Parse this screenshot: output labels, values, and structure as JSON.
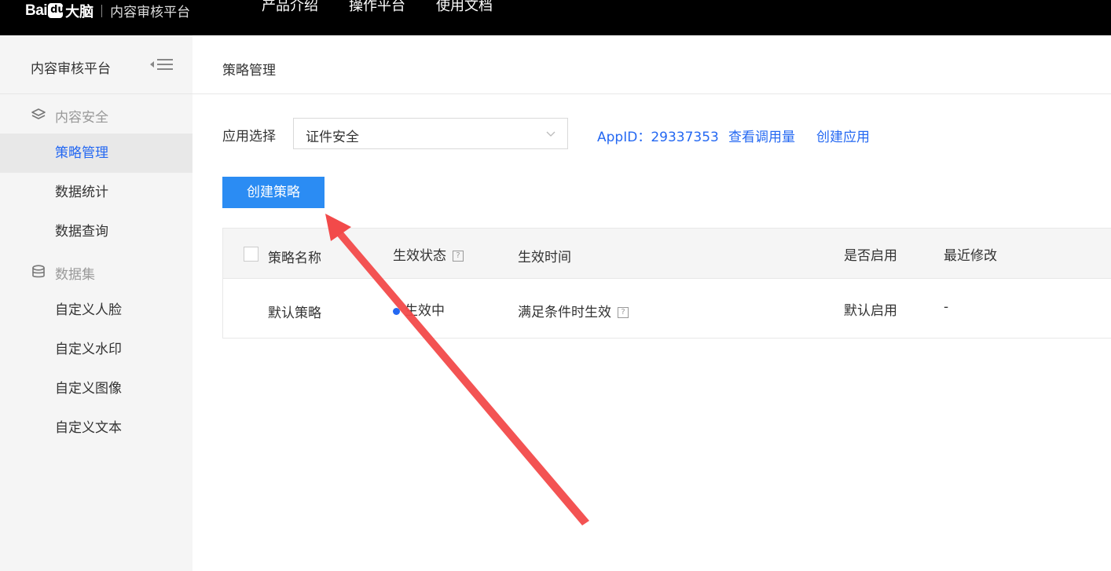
{
  "topbar": {
    "logo_bai": "Bai",
    "logo_du": "du",
    "logo_danao": "大脑",
    "platform_title": "内容审核平台",
    "nav": [
      "产品介绍",
      "操作平台",
      "使用文档"
    ]
  },
  "sidebar": {
    "title": "内容审核平台",
    "groups": [
      {
        "label": "内容安全",
        "items": [
          "策略管理",
          "数据统计",
          "数据查询"
        ]
      },
      {
        "label": "数据集",
        "items": [
          "自定义人脸",
          "自定义水印",
          "自定义图像",
          "自定义文本"
        ]
      }
    ],
    "active_item": "策略管理"
  },
  "main": {
    "breadcrumb": "策略管理",
    "app_select_label": "应用选择",
    "app_select_value": "证件安全",
    "appid": "AppID：29337353",
    "view_usage_link": "查看调用量",
    "create_app_link": "创建应用",
    "create_strategy_button": "创建策略",
    "table": {
      "headers": {
        "name": "策略名称",
        "status": "生效状态",
        "time": "生效时间",
        "enabled": "是否启用",
        "modified": "最近修改"
      },
      "rows": [
        {
          "name": "默认策略",
          "status": "生效中",
          "time": "满足条件时生效",
          "enabled": "默认启用",
          "modified": "-"
        }
      ]
    }
  },
  "colors": {
    "accent": "#2468f2",
    "button": "#2b8cf3",
    "annotation_arrow": "#f24a4a",
    "topbar": "#000000"
  }
}
